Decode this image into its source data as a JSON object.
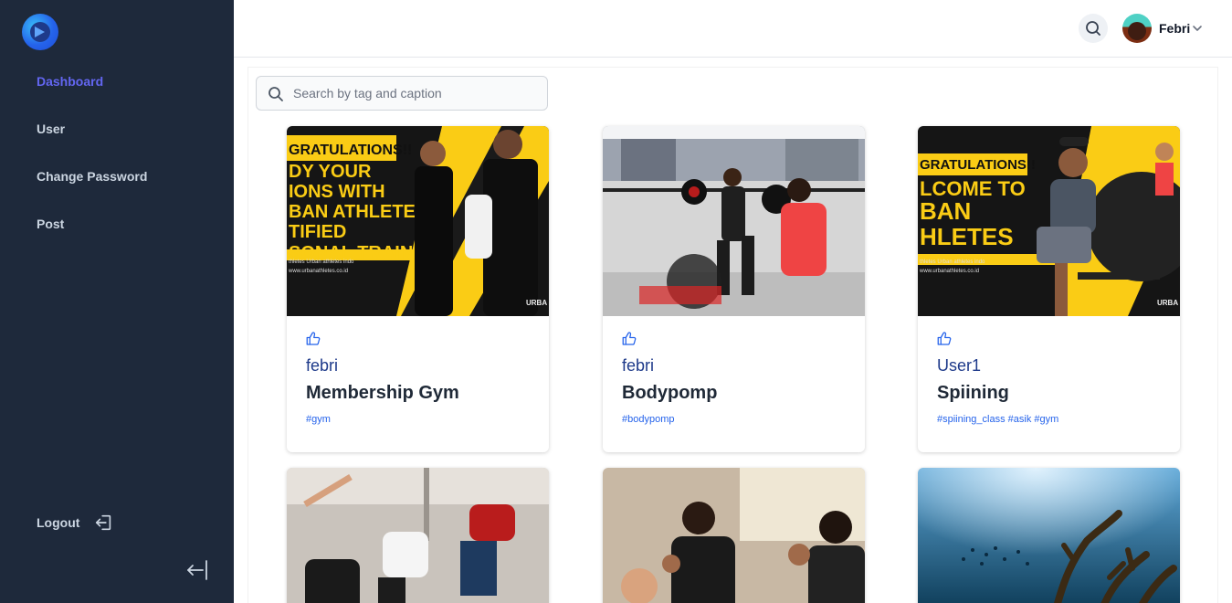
{
  "sidebar": {
    "items": [
      {
        "label": "Dashboard",
        "active": true
      },
      {
        "label": "User",
        "active": false
      },
      {
        "label": "Change Password",
        "active": false
      },
      {
        "label": "Post",
        "active": false
      }
    ],
    "logout_label": "Logout"
  },
  "header": {
    "user_name": "Febri"
  },
  "search": {
    "placeholder": "Search by tag and caption",
    "value": ""
  },
  "posts": [
    {
      "author": "febri",
      "title": "Membership Gym",
      "tags": "#gym",
      "image_text": {
        "line1": "GRATULATIONS!!",
        "line2": "DY YOUR",
        "line3": "IONS WITH",
        "line4": "BAN ATHLETES",
        "line5": "TIFIED",
        "line6": "SONAL TRAINER",
        "footer1": "thletes   Urban athletes indo",
        "footer2": "www.urbanathletes.co.id",
        "brand": "URBA"
      }
    },
    {
      "author": "febri",
      "title": "Bodypomp",
      "tags": "#bodypomp"
    },
    {
      "author": "User1",
      "title": "Spiining",
      "tags": "#spiining_class #asik #gym",
      "image_text": {
        "line1": "GRATULATIONS!!",
        "line2": "LCOME TO",
        "line3": "BAN",
        "line4": "HLETES",
        "footer1": "thletes   Urban athletes indo",
        "footer2": "www.urbanathletes.co.id",
        "brand": "URBA"
      }
    }
  ],
  "colors": {
    "sidebar_bg": "#1e293b",
    "active_nav": "#6366f1",
    "author": "#1e3a8a",
    "tag": "#2563eb",
    "banner_yellow": "#facc15"
  }
}
